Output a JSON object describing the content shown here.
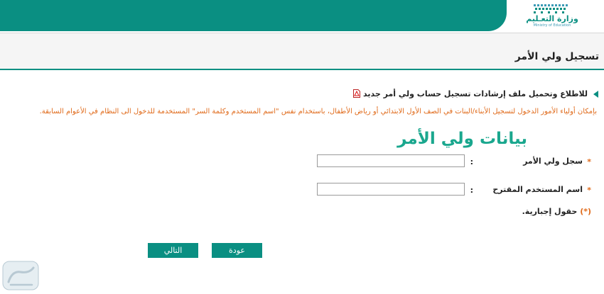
{
  "header": {
    "logo_text": "وزارة التعـليم",
    "logo_sub": "Ministry of Education",
    "colors": {
      "teal": "#0a8f82",
      "orange": "#e06a1a"
    }
  },
  "page": {
    "title": "تسجيل ولي الأمر"
  },
  "guidance": {
    "download_link": "للاطلاع وتحميل ملف إرشادات تسجيل حساب ولي أمر جديد",
    "download_icon": "pdf-icon",
    "notice": "بإمكان أولياء الأمور الدخول لتسجيل الأبناء/البنات في الصف الأول الابتدائي أو رياض الأطفال، باستخدام نفس \"اسم المستخدم وكلمة السر\" المستخدمة للدخول الى النظام في الأعوام السابقة."
  },
  "form": {
    "heading": "بيانات ولي الأمر",
    "fields": [
      {
        "label": "سجل ولي الأمر",
        "value": "",
        "required_mark": "*"
      },
      {
        "label": "اسم المستخدم المقترح",
        "value": "",
        "required_mark": "*"
      }
    ],
    "colon": ":",
    "required_note": "حقول إجبارية.",
    "required_note_mark": "(*)"
  },
  "buttons": {
    "back": "عودة",
    "next": "التالي"
  }
}
